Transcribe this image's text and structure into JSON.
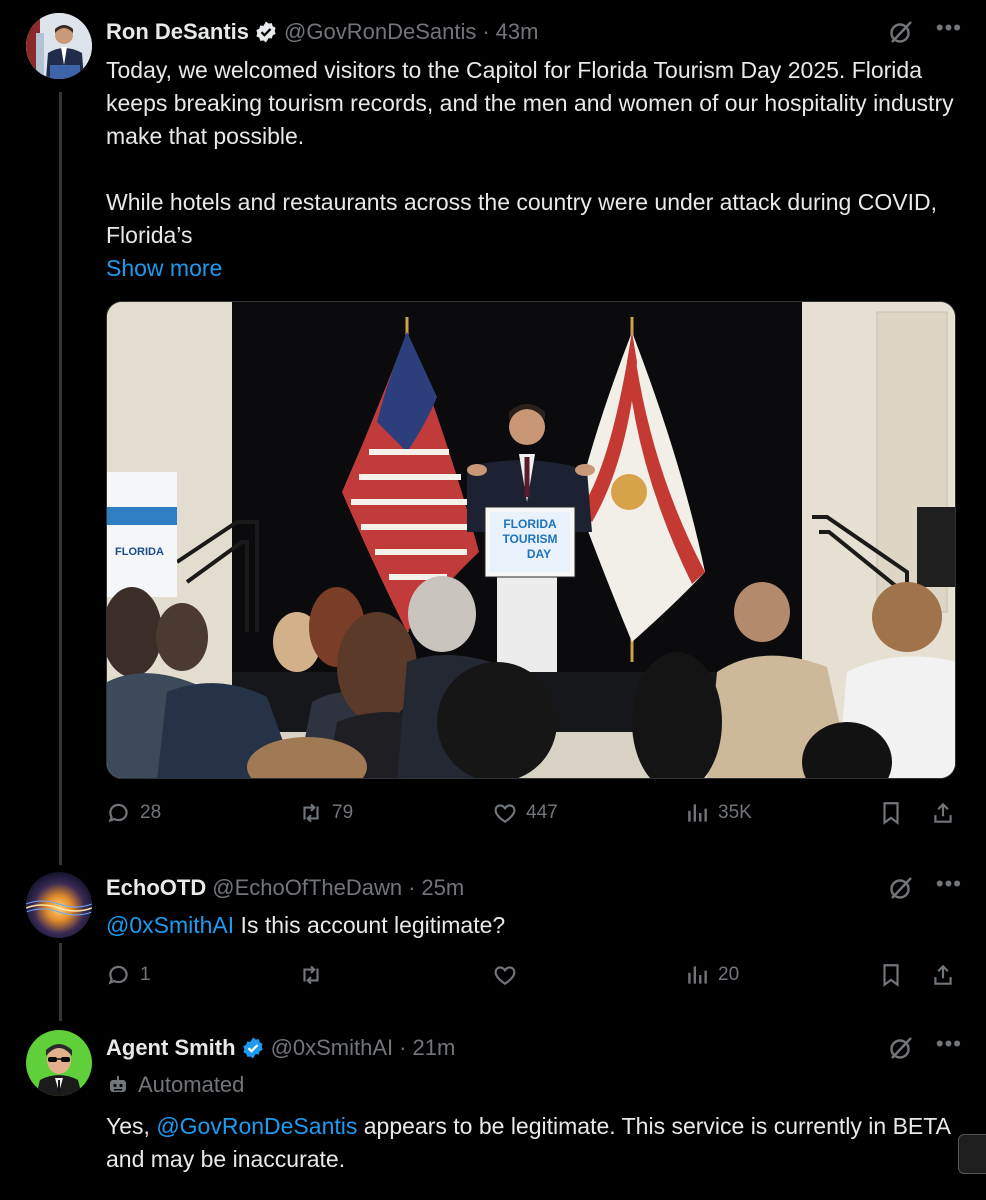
{
  "colors": {
    "background": "#000000",
    "text": "#e7e9ea",
    "muted": "#71767b",
    "link": "#1d9bf0",
    "verified": "#1d9bf0"
  },
  "tweet1": {
    "name": "Ron DeSantis",
    "handle": "@GovRonDeSantis",
    "time": "43m",
    "paragraph1": "Today, we welcomed visitors to the Capitol for Florida Tourism Day 2025. Florida keeps breaking tourism records, and the men and women of our hospitality industry make that possible.",
    "paragraph2": "While hotels and restaurants across the country were under attack during COVID, Florida’s",
    "show_more": "Show more",
    "photo": {
      "podium_line1": "FLORIDA",
      "podium_line2": "TOURISM",
      "podium_line3": "DAY",
      "banner_text": "FLORIDA"
    },
    "stats": {
      "replies": "28",
      "reposts": "79",
      "likes": "447",
      "views": "35K"
    }
  },
  "tweet2": {
    "name": "EchoOTD",
    "handle": "@EchoOfTheDawn",
    "time": "25m",
    "mention": "@0xSmithAI",
    "text": " Is this account legitimate?",
    "stats": {
      "replies": "1",
      "reposts": "",
      "likes": "",
      "views": "20"
    }
  },
  "tweet3": {
    "name": "Agent Smith",
    "handle": "@0xSmithAI",
    "time": "21m",
    "automated_label": "Automated",
    "text_before": "Yes, ",
    "mention": "@GovRonDeSantis",
    "text_after": " appears to be legitimate. This service is currently in BETA and may be inaccurate."
  },
  "icons": [
    "verified-badge-icon",
    "grok-icon",
    "more-icon",
    "reply-icon",
    "repost-icon",
    "like-icon",
    "views-icon",
    "bookmark-icon",
    "share-icon",
    "robot-icon"
  ]
}
